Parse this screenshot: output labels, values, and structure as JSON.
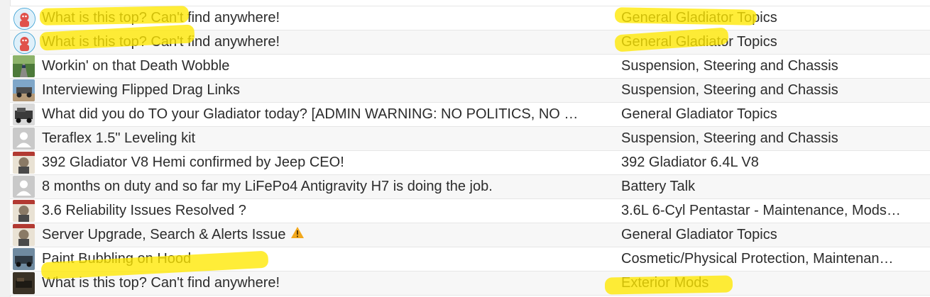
{
  "colors": {
    "highlight": "#ffe600",
    "text": "#2c2c2c",
    "row_alt": "#f7f7f7",
    "border": "#e6e6e6"
  },
  "rows": [
    {
      "title": "What is this top? Can't find anywhere!",
      "forum": "General Gladiator Topics",
      "avatar": "cartoon-avatar"
    },
    {
      "title": "What is this top? Can't find anywhere!",
      "forum": "General Gladiator Topics",
      "avatar": "cartoon-avatar"
    },
    {
      "title": "Workin' on that Death Wobble",
      "forum": "Suspension, Steering and Chassis",
      "avatar": "road-photo-avatar"
    },
    {
      "title": "Interviewing Flipped Drag Links",
      "forum": "Suspension, Steering and Chassis",
      "avatar": "jeep-photo-avatar"
    },
    {
      "title": "What did you do TO your Gladiator today? [ADMIN WARNING: NO POLITICS, NO …",
      "forum": "General Gladiator Topics",
      "avatar": "truck-photo-avatar"
    },
    {
      "title": "Teraflex 1.5\" Leveling kit",
      "forum": "Suspension, Steering and Chassis",
      "avatar": "default-user-avatar"
    },
    {
      "title": "392 Gladiator V8 Hemi confirmed by Jeep CEO!",
      "forum": "392 Gladiator 6.4L V8",
      "avatar": "poster-avatar"
    },
    {
      "title": "8 months on duty and so far my LiFePo4 Antigravity H7 is doing the job.",
      "forum": "Battery Talk",
      "avatar": "default-user-avatar"
    },
    {
      "title": "3.6 Reliability Issues Resolved ?",
      "forum": "3.6L 6-Cyl Pentastar - Maintenance, Mods…",
      "avatar": "poster-avatar"
    },
    {
      "title": "Server Upgrade, Search & Alerts Issue",
      "forum": "General Gladiator Topics",
      "avatar": "poster-avatar",
      "icon": "warning-icon"
    },
    {
      "title": "Paint Bubbling on Hood",
      "forum": "Cosmetic/Physical Protection, Maintenan…",
      "avatar": "truck-photo-avatar"
    },
    {
      "title": "What is this top? Can't find anywhere!",
      "forum": "Exterior Mods",
      "avatar": "dark-photo-avatar"
    }
  ]
}
